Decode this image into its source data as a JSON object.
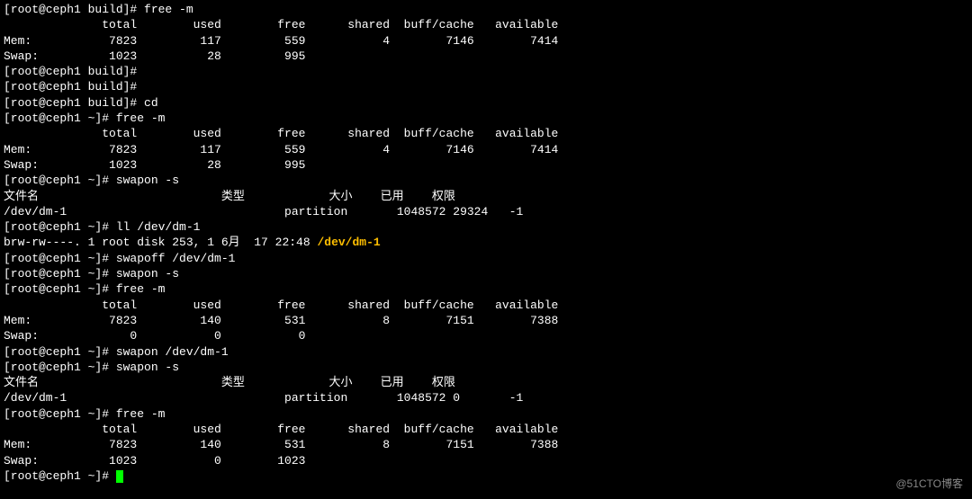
{
  "lines": {
    "l01": "[root@ceph1 build]# free -m",
    "l02": "              total        used        free      shared  buff/cache   available",
    "l03": "Mem:           7823         117         559           4        7146        7414",
    "l04": "Swap:          1023          28         995",
    "l05": "[root@ceph1 build]#",
    "l06": "[root@ceph1 build]#",
    "l07": "[root@ceph1 build]# cd",
    "l08": "[root@ceph1 ~]# free -m",
    "l09": "              total        used        free      shared  buff/cache   available",
    "l10": "Mem:           7823         117         559           4        7146        7414",
    "l11": "Swap:          1023          28         995",
    "l12": "[root@ceph1 ~]# swapon -s",
    "l13": "文件名                          类型            大小    已用    权限",
    "l14": "/dev/dm-1                               partition       1048572 29324   -1",
    "l15": "[root@ceph1 ~]# ll /dev/dm-1",
    "l16a": "brw-rw----. 1 root disk 253, 1 6月  17 22:48 ",
    "l16b": "/dev/dm-1",
    "l17": "[root@ceph1 ~]# swapoff /dev/dm-1",
    "l18": "[root@ceph1 ~]# swapon -s",
    "l19": "[root@ceph1 ~]# free -m",
    "l20": "              total        used        free      shared  buff/cache   available",
    "l21": "Mem:           7823         140         531           8        7151        7388",
    "l22": "Swap:             0           0           0",
    "l23": "[root@ceph1 ~]# swapon /dev/dm-1",
    "l24": "[root@ceph1 ~]# swapon -s",
    "l25": "文件名                          类型            大小    已用    权限",
    "l26": "/dev/dm-1                               partition       1048572 0       -1",
    "l27": "[root@ceph1 ~]# free -m",
    "l28": "              total        used        free      shared  buff/cache   available",
    "l29": "Mem:           7823         140         531           8        7151        7388",
    "l30": "Swap:          1023           0        1023",
    "l31": "[root@ceph1 ~]# "
  },
  "watermark": "@51CTO博客"
}
